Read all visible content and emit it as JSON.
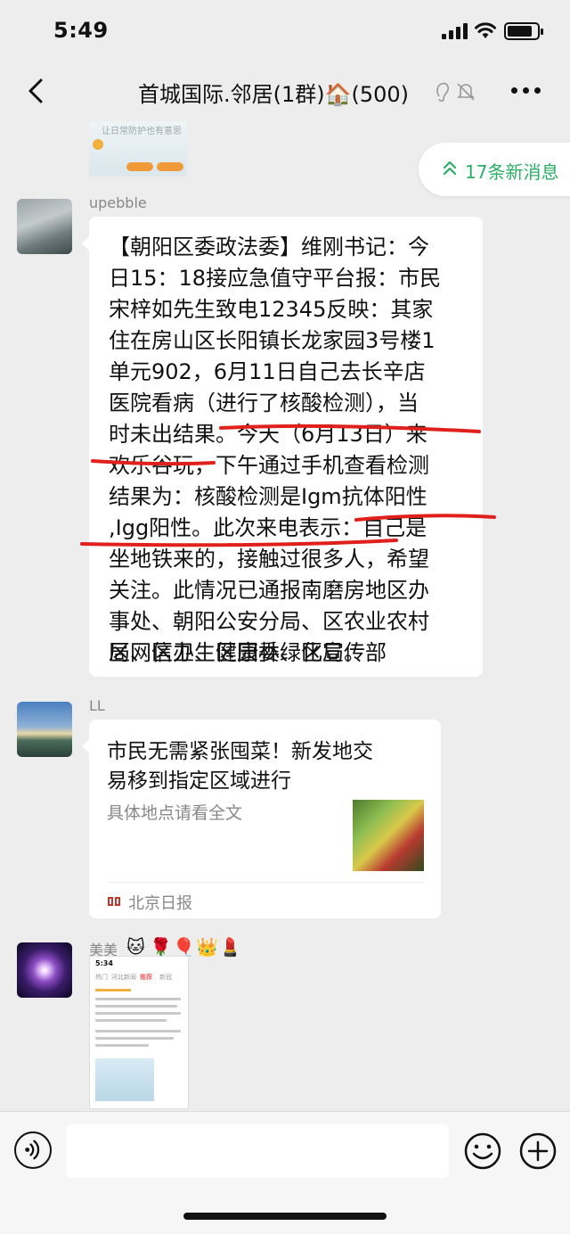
{
  "status_bar": {
    "time": "5:49",
    "signal_icon": "cellular-signal-icon",
    "wifi_icon": "wifi-icon",
    "battery_icon": "battery-icon",
    "battery_level": 0.85
  },
  "nav": {
    "back_icon": "chevron-left-icon",
    "title": "首城国际.邻居(1群)🏠(500)",
    "title_icons": [
      "ear-icon",
      "mute-bell-icon"
    ],
    "more_icon": "ellipsis-icon"
  },
  "top_image": {
    "text": "让日常防护也有意思"
  },
  "new_messages": {
    "icon": "double-chevron-up-icon",
    "label": "17条新消息",
    "color": "#2aae67"
  },
  "messages": [
    {
      "sender": "upebble",
      "lines": [
        "【朝阳区委政法委】维刚书记：今",
        "日15：18接应急值守平台报：市民",
        "宋梓如先生致电12345反映：其家",
        "住在房山区长阳镇长龙家园3号楼1",
        "单元902，6月11日自己去长辛店",
        "医院看病（进行了核酸检测），当",
        "时未出结果。今天（6月13日）来",
        "欢乐谷玩，下午通过手机查看检测",
        "结果为：核酸检测是Igm抗体阳性",
        ",Igg阳性。此次来电表示：自己是",
        "坐地铁来的，接触过很多人，希望",
        "关注。此情况已通报南磨房地区办",
        "事处、朝阳公安分局、区农业农村",
        "局、区卫生健康委、区宣传部",
        "区网信办、区园林绿化局。"
      ],
      "annotation_color": "#e0201c"
    },
    {
      "sender": "LL",
      "link_title_lines": [
        "市民无需紧张囤菜！新发地交",
        "易移到指定区域进行"
      ],
      "link_desc": "具体地点请看全文",
      "source": "北京日报",
      "source_icon": "beijing-daily-logo-icon"
    },
    {
      "sender": "美美",
      "sender_emojis": [
        "🐱",
        "🌹",
        "🎈",
        "👑",
        "💄"
      ],
      "screenshot": {
        "time": "5:34",
        "tabs": [
          "热门",
          "河北新闻",
          "推荐",
          "新冠"
        ]
      }
    }
  ],
  "input_bar": {
    "voice_icon": "voice-icon",
    "emoji_icon": "smiley-icon",
    "plus_icon": "plus-circle-icon",
    "placeholder": ""
  }
}
